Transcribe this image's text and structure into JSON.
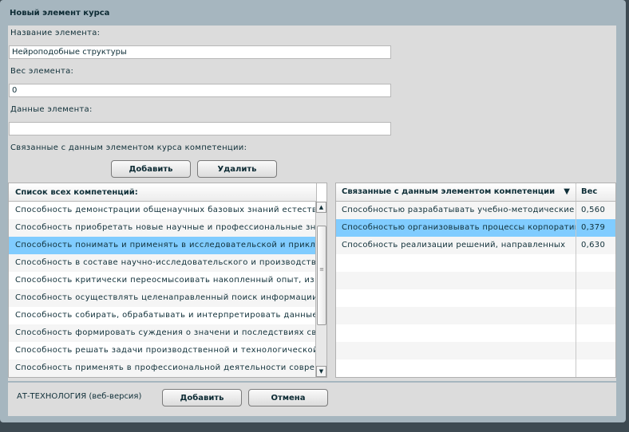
{
  "window": {
    "title": "Новый элемент курса"
  },
  "form": {
    "name_label": "Название элемента:",
    "name_value": "Нейроподобные структуры",
    "weight_label": "Вес элемента:",
    "weight_value": "0",
    "data_label": "Данные элемента:",
    "data_value": "",
    "linked_label": "Связанные с данным элементом курса компетенции:",
    "add_label": "Добавить",
    "remove_label": "Удалить"
  },
  "all_list": {
    "header": "Список всех компетенций:",
    "selected_index": 2,
    "items": [
      "Способность демонстрации общенаучных базовых знаний естественных наук",
      "Способность приобретать новые научные и профессиональные знания",
      "Способность понимать и применять в исследовательской и прикладной деятельности",
      "Способность в составе научно-исследовательского и производственного коллектива",
      "Способность критически переосмысоивать накопленный опыт, изменять",
      "Способность осуществлять целенаправленный поиск информации",
      "Способность собирать, обрабатывать и интерпретировать данные",
      "Способность формировать суждения о значени и последствиях своей",
      "Способность решать задачи производственной и технологической",
      "Способность применять в профессиональной деятельности современные"
    ]
  },
  "linked_table": {
    "col_name": "Связанные с данным элементом компетенции",
    "col_weight": "Вес",
    "sort_icon": "sort-down-icon",
    "rows": [
      {
        "name": "Способностью разрабатывать учебно-методические",
        "weight": "0,560"
      },
      {
        "name": "Способностью организовывать процессы корпоративного",
        "weight": "0,379"
      },
      {
        "name": "Способность реализации решений, направленных",
        "weight": "0,630"
      }
    ]
  },
  "footer": {
    "brand": "АТ-ТЕХНОЛОГИЯ (веб-версия)",
    "add_label": "Добавить",
    "cancel_label": "Отмена"
  }
}
